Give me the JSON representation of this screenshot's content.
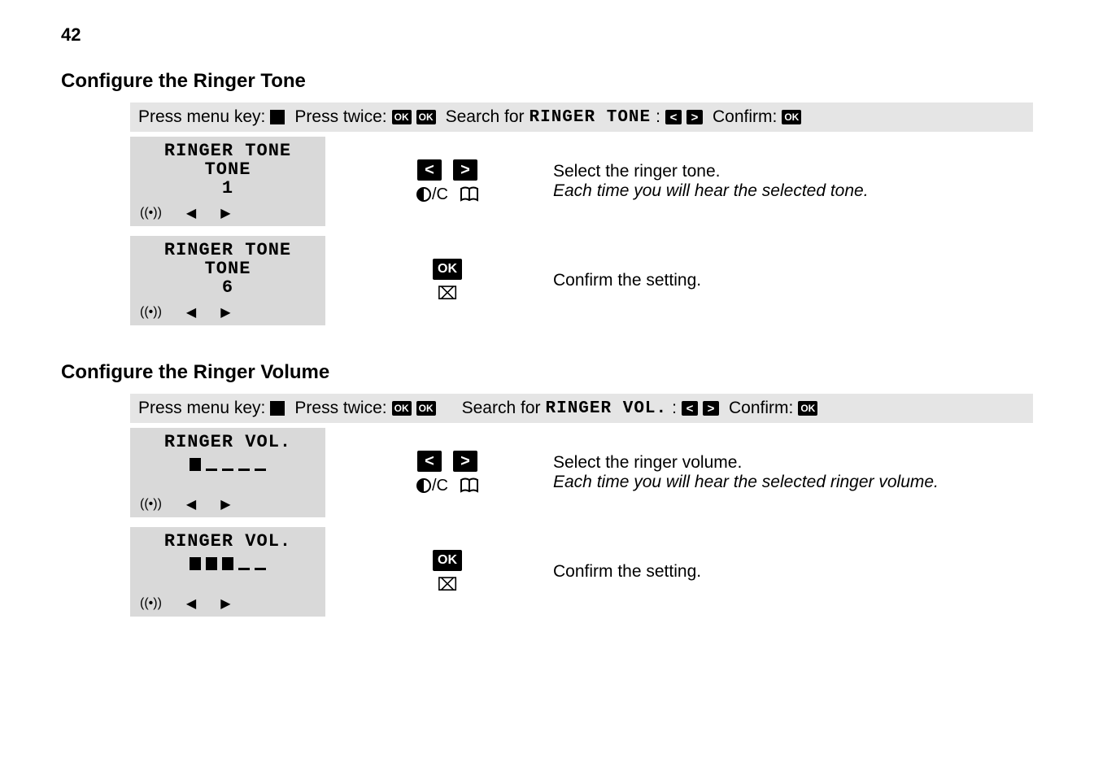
{
  "page_number": "42",
  "section1": {
    "title": "Configure the Ringer Tone",
    "bar": {
      "press_menu": "Press menu key:",
      "press_twice": "Press twice:",
      "search_for": "Search for",
      "search_target": "RINGER TONE",
      "confirm": "Confirm:"
    },
    "step1": {
      "lcd_line1": "RINGER TONE",
      "lcd_line2": "TONE",
      "lcd_line3": "1",
      "desc_main": "Select the ringer tone.",
      "desc_note": "Each time you will hear the selected tone.",
      "below_c": "/C"
    },
    "step2": {
      "lcd_line1": "RINGER TONE",
      "lcd_line2": "TONE",
      "lcd_line3": "6",
      "desc_main": "Confirm the setting.",
      "ok_label": "OK"
    }
  },
  "section2": {
    "title": "Configure the Ringer Volume",
    "bar": {
      "press_menu": "Press menu key:",
      "press_twice": "Press twice:",
      "search_for": "Search for",
      "search_target": "RINGER VOL.",
      "confirm": "Confirm:"
    },
    "step1": {
      "lcd_line1": "RINGER VOL.",
      "vol_filled": 1,
      "vol_total": 5,
      "desc_main": "Select the ringer volume.",
      "desc_note": "Each time you will hear the selected ringer volume.",
      "below_c": "/C"
    },
    "step2": {
      "lcd_line1": "RINGER VOL.",
      "vol_filled": 3,
      "vol_total": 5,
      "desc_main": "Confirm the setting.",
      "ok_label": "OK"
    }
  },
  "ok_text": "OK"
}
